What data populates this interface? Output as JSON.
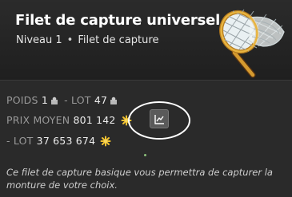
{
  "item": {
    "name": "Filet de capture universel",
    "level": "Niveau 1",
    "category": "Filet de capture"
  },
  "stats": {
    "weight_label": "POIDS",
    "weight_value": "1",
    "lot_label": "- LOT",
    "lot_value": "47",
    "avg_price_label": "PRIX MOYEN",
    "avg_price_value": "801 142",
    "lot_price_label": "- LOT",
    "lot_price_value": "37 653 674"
  },
  "description": "Ce filet de capture basique vous permettra de capturer la monture de votre choix.",
  "icons": {
    "weight": "weight-icon",
    "kama": "kama-currency-icon",
    "chart": "chart-icon",
    "net": "capture-net-icon"
  },
  "colors": {
    "kama": "#f2c230",
    "highlight": "#ffffff"
  }
}
